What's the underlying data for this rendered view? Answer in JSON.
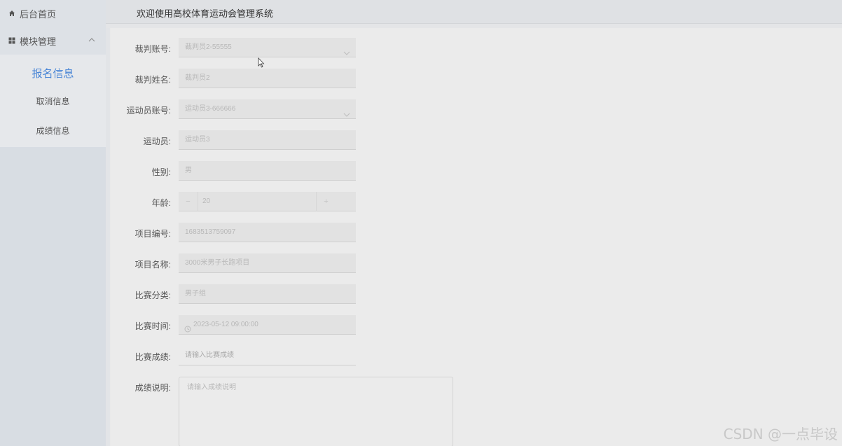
{
  "sidebar": {
    "home_label": "后台首页",
    "module_label": "模块管理",
    "items": [
      {
        "label": "报名信息",
        "active": true
      },
      {
        "label": "取消信息",
        "active": false
      },
      {
        "label": "成绩信息",
        "active": false
      }
    ]
  },
  "header": {
    "title": "欢迎使用高校体育运动会管理系统"
  },
  "form": {
    "referee_account": {
      "label": "裁判账号:",
      "value": "裁判员2-55555"
    },
    "referee_name": {
      "label": "裁判姓名:",
      "value": "裁判员2"
    },
    "athlete_account": {
      "label": "运动员账号:",
      "value": "运动员3-666666"
    },
    "athlete": {
      "label": "运动员:",
      "value": "运动员3"
    },
    "gender": {
      "label": "性别:",
      "value": "男"
    },
    "age": {
      "label": "年龄:",
      "value": "20",
      "minus": "−",
      "plus": "+"
    },
    "project_no": {
      "label": "项目编号:",
      "value": "1683513759097"
    },
    "project_name": {
      "label": "项目名称:",
      "value": "3000米男子长跑项目"
    },
    "category": {
      "label": "比赛分类:",
      "value": "男子组"
    },
    "match_time": {
      "label": "比赛时间:",
      "value": "2023-05-12 09:00:00"
    },
    "score": {
      "label": "比赛成绩:",
      "placeholder": "请输入比赛成绩"
    },
    "score_desc": {
      "label": "成绩说明:",
      "placeholder": "请输入成绩说明"
    }
  },
  "watermark": "CSDN @一点毕设",
  "icons": {
    "home": "home-icon",
    "grid": "grid-icon",
    "chevron": "chevron-up-icon",
    "caret": "chevron-down-icon",
    "clock": "clock-icon"
  },
  "colors": {
    "accent": "#4a86d6",
    "sidebar": "#dde1e6",
    "background": "#e9e9e9"
  }
}
